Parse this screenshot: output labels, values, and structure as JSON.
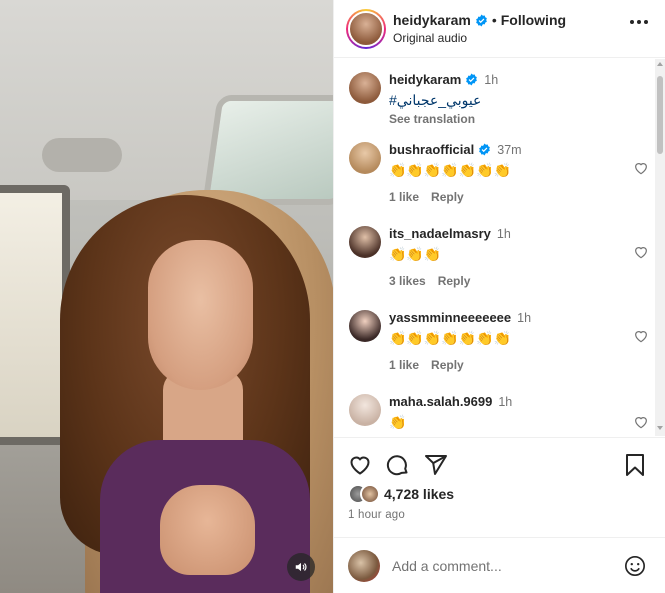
{
  "post": {
    "username": "heidykaram",
    "following_label": "Following",
    "audio": "Original audio"
  },
  "caption": {
    "username": "heidykaram",
    "time": "1h",
    "hashtag": "#عيوبي_عجباني",
    "see_translation": "See translation"
  },
  "comments": [
    {
      "username": "bushraofficial",
      "verified": true,
      "time": "37m",
      "text": "👏👏👏👏👏👏👏",
      "likes": "1 like",
      "reply": "Reply"
    },
    {
      "username": "its_nadaelmasry",
      "verified": false,
      "time": "1h",
      "text": "👏👏👏",
      "likes": "3 likes",
      "reply": "Reply"
    },
    {
      "username": "yassmminneeeeeee",
      "verified": false,
      "time": "1h",
      "text": "👏👏👏👏👏👏👏",
      "likes": "1 like",
      "reply": "Reply"
    },
    {
      "username": "maha.salah.9699",
      "verified": false,
      "time": "1h",
      "text": "👏",
      "likes": "",
      "reply": ""
    }
  ],
  "actions": {
    "likes_count": "4,728 likes",
    "posted": "1 hour ago"
  },
  "add_comment": {
    "placeholder": "Add a comment..."
  },
  "colors": {
    "verified": "#0095f6",
    "hashtag": "#00376b",
    "secondary_text": "#737373"
  },
  "icons": [
    "more-icon",
    "heart-icon",
    "comment-icon",
    "share-icon",
    "bookmark-icon",
    "emoji-icon",
    "speaker-icon",
    "verified-icon"
  ]
}
